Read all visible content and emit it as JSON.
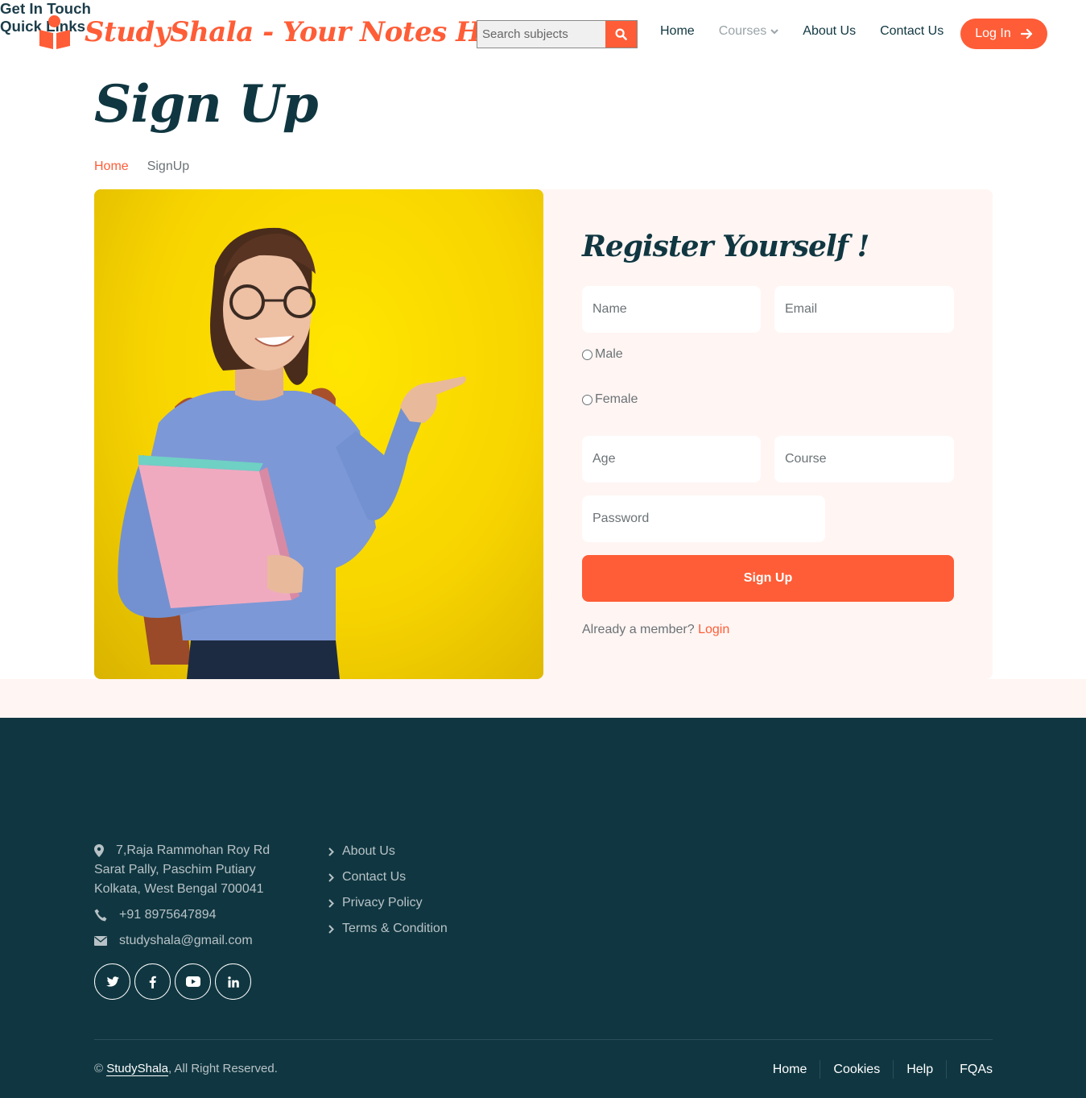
{
  "header": {
    "brand": "StudyShala - Your Notes Hub",
    "search_placeholder": "Search subjects",
    "nav": {
      "home": "Home",
      "courses": "Courses",
      "about": "About Us",
      "contact": "Contact Us"
    },
    "login_label": "Log In"
  },
  "page": {
    "title": "Sign Up",
    "breadcrumb": {
      "home": "Home",
      "current": "SignUp"
    }
  },
  "form": {
    "title": "Register Yourself !",
    "name_placeholder": "Name",
    "email_placeholder": "Email",
    "gender_options": [
      "Male",
      "Female"
    ],
    "age_placeholder": "Age",
    "course_placeholder": "Course",
    "password_placeholder": "Password",
    "submit_label": "Sign Up",
    "member_prompt": "Already a member?",
    "login_link": "Login"
  },
  "footer": {
    "contact": {
      "heading": "Get In Touch",
      "address_lines": [
        "7,Raja Rammohan Roy Rd",
        "Sarat Pally, Paschim Putiary",
        "Kolkata, West Bengal 700041"
      ],
      "phone": "+91 8975647894",
      "email": "studyshala@gmail.com"
    },
    "quick_links": {
      "heading": "Quick Links",
      "items": [
        "About Us",
        "Contact Us",
        "Privacy Policy",
        "Terms & Condition"
      ]
    },
    "social_icons": [
      "twitter-icon",
      "facebook-icon",
      "youtube-icon",
      "linkedin-icon"
    ],
    "copyright_symbol": "©",
    "copyright_brand": "StudyShala",
    "copyright_rest": ", All Right Reserved.",
    "menu": [
      "Home",
      "Cookies",
      "Help",
      "FQAs"
    ]
  },
  "colors": {
    "accent": "#fe5d37",
    "dark": "#103741",
    "panel": "#fff5f3",
    "photo_bg": "#f7d400"
  }
}
